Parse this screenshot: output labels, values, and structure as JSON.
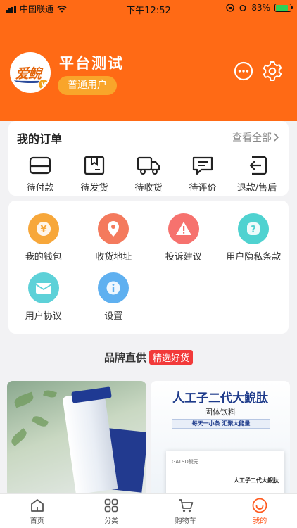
{
  "status_bar": {
    "carrier": "中国联通",
    "time": "下午12:52",
    "battery": "83%"
  },
  "profile": {
    "avatar_text": "爱鲵",
    "avatar_badge": "V",
    "username": "平台测试",
    "level": "普通用户"
  },
  "header_icons": [
    "message-icon",
    "settings-gear-icon"
  ],
  "orders": {
    "title": "我的订单",
    "view_all": "查看全部",
    "items": [
      {
        "label": "待付款",
        "icon": "wallet-card-icon"
      },
      {
        "label": "待发货",
        "icon": "package-box-icon"
      },
      {
        "label": "待收货",
        "icon": "delivery-truck-icon"
      },
      {
        "label": "待评价",
        "icon": "comment-icon"
      },
      {
        "label": "退款/售后",
        "icon": "return-arrow-icon"
      }
    ]
  },
  "services": {
    "items": [
      {
        "label": "我的钱包",
        "icon": "yen-wallet-icon",
        "color": "#f7a73a"
      },
      {
        "label": "收货地址",
        "icon": "location-pin-icon",
        "color": "#f47a5d"
      },
      {
        "label": "投诉建议",
        "icon": "warning-icon",
        "color": "#f6726e"
      },
      {
        "label": "用户隐私条款",
        "icon": "question-icon",
        "color": "#4fd2d0"
      },
      {
        "label": "用户协议",
        "icon": "agreement-envelope-icon",
        "color": "#5dd1d8"
      },
      {
        "label": "设置",
        "icon": "info-icon",
        "color": "#5fb0f0"
      }
    ]
  },
  "brand": {
    "title": "品牌直供",
    "tag": "精选好货"
  },
  "products": [
    {
      "name": "facial-cleanser-product"
    },
    {
      "title": "人工子二代大鲵肽",
      "subtitle": "固体饮料",
      "banner": "每天一小条 汇聚大能量",
      "brand": "GATSD鲵元",
      "box_title": "人工子二代大鲵肽"
    }
  ],
  "tabbar": {
    "items": [
      {
        "label": "首页",
        "icon": "home-icon",
        "active": false
      },
      {
        "label": "分类",
        "icon": "category-grid-icon",
        "active": false
      },
      {
        "label": "购物车",
        "icon": "cart-icon",
        "active": false
      },
      {
        "label": "我的",
        "icon": "profile-icon",
        "active": true
      }
    ]
  },
  "colors": {
    "header": "#ff6a15",
    "level_badge": "#f9a52a",
    "accent": "#ff5a1f",
    "tag": "#f23a3a"
  }
}
